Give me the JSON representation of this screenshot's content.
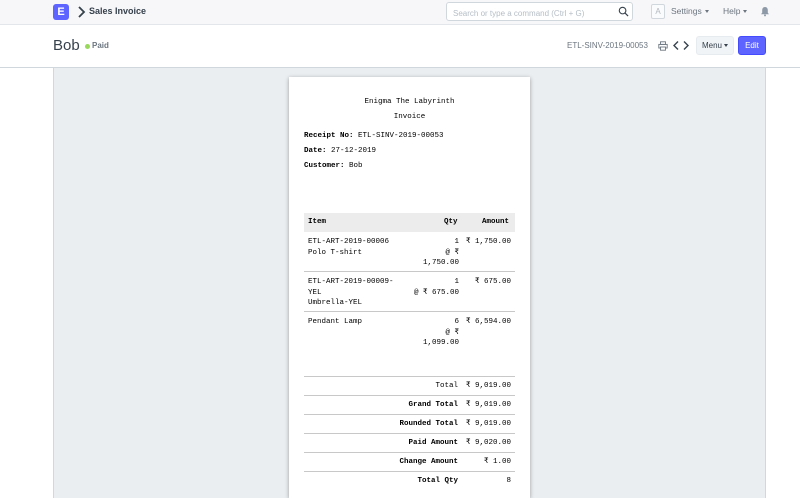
{
  "navbar": {
    "logo_letter": "E",
    "breadcrumb": "Sales Invoice",
    "search_placeholder": "Search or type a command (Ctrl + G)",
    "avatar_letter": "A",
    "settings_label": "Settings",
    "help_label": "Help"
  },
  "page": {
    "title": "Bob",
    "status": "Paid",
    "doc_name": "ETL-SINV-2019-00053",
    "menu_label": "Menu",
    "edit_label": "Edit"
  },
  "receipt": {
    "company": "Enigma The Labyrinth",
    "title": "Invoice",
    "receipt_no_label": "Receipt No:",
    "receipt_no": "ETL-SINV-2019-00053",
    "date_label": "Date:",
    "date": "27-12-2019",
    "customer_label": "Customer:",
    "customer": "Bob",
    "columns": {
      "item": "Item",
      "qty": "Qty",
      "amount": "Amount"
    },
    "items": [
      {
        "code": "ETL-ART-2019-00006",
        "name": "Polo T-shirt",
        "qty": "1",
        "rate_line1": "@ ₹",
        "rate_line2": "1,750.00",
        "amount": "₹ 1,750.00"
      },
      {
        "code_line1": "ETL-ART-2019-00009-",
        "code_line2": "YEL",
        "name": "Umbrella-YEL",
        "qty": "1",
        "rate_line1": "@ ₹ 675.00",
        "amount": "₹ 675.00"
      },
      {
        "name": "Pendant Lamp",
        "qty": "6",
        "rate_line1": "@ ₹",
        "rate_line2": "1,099.00",
        "amount": "₹ 6,594.00"
      }
    ],
    "totals": [
      {
        "label": "Total",
        "value": "₹ 9,019.00",
        "bold": false
      },
      {
        "label": "Grand Total",
        "value": "₹ 9,019.00",
        "bold": true
      },
      {
        "label": "Rounded Total",
        "value": "₹ 9,019.00",
        "bold": true
      },
      {
        "label": "Paid Amount",
        "value": "₹ 9,020.00",
        "bold": true
      },
      {
        "label": "Change Amount",
        "value": "₹ 1.00",
        "bold": true
      },
      {
        "label": "Total Qty",
        "value": "8",
        "bold": true
      }
    ]
  },
  "colors": {
    "accent": "#5e64ff",
    "status_paid": "#98d85b",
    "print_bg": "#ebeef1"
  },
  "icons": [
    "chevron-right-icon",
    "search-icon",
    "bell-icon",
    "print-icon",
    "chevron-left-icon",
    "chevron-right-icon"
  ]
}
